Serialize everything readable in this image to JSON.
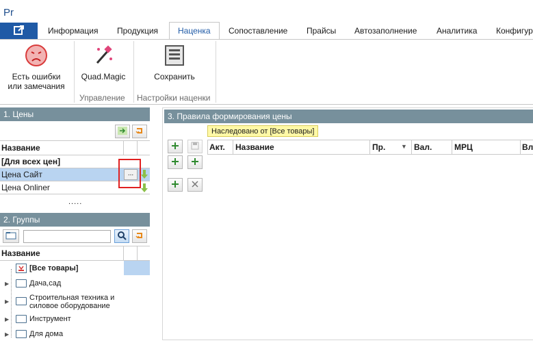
{
  "app": {
    "title": "Pr"
  },
  "tabs": [
    {
      "label": "Информация"
    },
    {
      "label": "Продукция"
    },
    {
      "label": "Наценка"
    },
    {
      "label": "Сопоставление"
    },
    {
      "label": "Прайсы"
    },
    {
      "label": "Автозаполнение"
    },
    {
      "label": "Аналитика"
    },
    {
      "label": "Конфигур"
    }
  ],
  "ribbon": {
    "errors_label_1": "Есть ошибки",
    "errors_label_2": "или замечания",
    "quadmagic_label": "Quad.Magic",
    "save_label": "Сохранить",
    "group_manage": "Управление",
    "group_settings": "Настройки наценки"
  },
  "prices_panel": {
    "title": "1. Цены",
    "col_name": "Название",
    "rows": [
      {
        "name": "[Для всех цен]"
      },
      {
        "name": "Цена Сайт"
      },
      {
        "name": "Цена Onliner"
      }
    ],
    "ellipsis": "...",
    "more": "....."
  },
  "groups_panel": {
    "title": "2. Группы",
    "search_placeholder": "",
    "col_name": "Название",
    "items": [
      {
        "label": "[Все товары]"
      },
      {
        "label": "Дача,сад"
      },
      {
        "label": "Строительная техника и"
      },
      {
        "label": "силовое оборудование"
      },
      {
        "label": "Инструмент"
      },
      {
        "label": "Для дома"
      }
    ]
  },
  "rules_panel": {
    "title": "3. Правила формирования цены",
    "inherited_badge": "Наследовано от [Все товары]",
    "columns": {
      "act": "Акт.",
      "name": "Название",
      "pr": "Пр.",
      "val": "Вал.",
      "mrc": "МРЦ",
      "more": "Вл"
    }
  },
  "colors": {
    "brand": "#1f5aa6",
    "panel_header": "#77909c",
    "selected_row": "#b9d4f1",
    "highlight_box": "#e02020",
    "badge": "#fff9a6"
  }
}
